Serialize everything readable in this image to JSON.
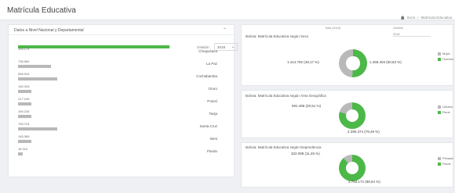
{
  "app": {
    "title": "Matrícula Educativa"
  },
  "breadcrumb": [
    "Inicio",
    "Matrícula Educativa"
  ],
  "colors": {
    "green": "#4cb848",
    "gray": "#b9b9b9"
  },
  "left": {
    "title": "Datos a Nivel Nacional y Departamental",
    "year_label": "Gestión",
    "year_value": "2018",
    "rows": [
      {
        "dept": "Chuquisaca",
        "value": "159.174",
        "level": 0.92,
        "color": "green"
      },
      {
        "dept": "La Paz",
        "value": "736.962",
        "level": 0.2
      },
      {
        "dept": "Cochabamba",
        "value": "556.924",
        "level": 0.24
      },
      {
        "dept": "Oruro",
        "value": "140.343",
        "level": 0.08
      },
      {
        "dept": "Potosí",
        "value": "217.109",
        "level": 0.08
      },
      {
        "dept": "Tarija",
        "value": "150.234",
        "level": 0.08
      },
      {
        "dept": "Santa Cruz",
        "value": "795.724",
        "level": 0.24
      },
      {
        "dept": "Beni",
        "value": "145.369",
        "level": 0.08
      },
      {
        "dept": "Pando",
        "value": "16.310",
        "level": 0.03
      }
    ]
  },
  "right": {
    "filter_label": "Gestión",
    "filter_value": "2018",
    "total_label": "Total (2018)",
    "p1": {
      "title": "Bolivia: Matrícula Educativa según Sexo",
      "label_left": "1.414.792 (49,17 %)",
      "label_right": "1.458.403 (50,83 %)",
      "share_green": 0.5083,
      "legend": [
        "Mujer",
        "Hombre"
      ]
    },
    "p2": {
      "title": "Bolivia: Matrícula Educativa según Área Geográfica",
      "label_top": "591.486 (20,51 %)",
      "label_bottom": "2.290.374 (79,49 %)",
      "share_green": 0.7949,
      "legend": [
        "Urbano",
        "Rural"
      ]
    },
    "p3": {
      "title": "Bolivia: Matrícula Educativa según Dependencia",
      "label_top": "322.098 (11,46 %)",
      "label_bottom": "2.753.172 (88,54 %)",
      "share_green": 0.8854,
      "legend": [
        "Privada",
        "Fiscal"
      ]
    }
  }
}
